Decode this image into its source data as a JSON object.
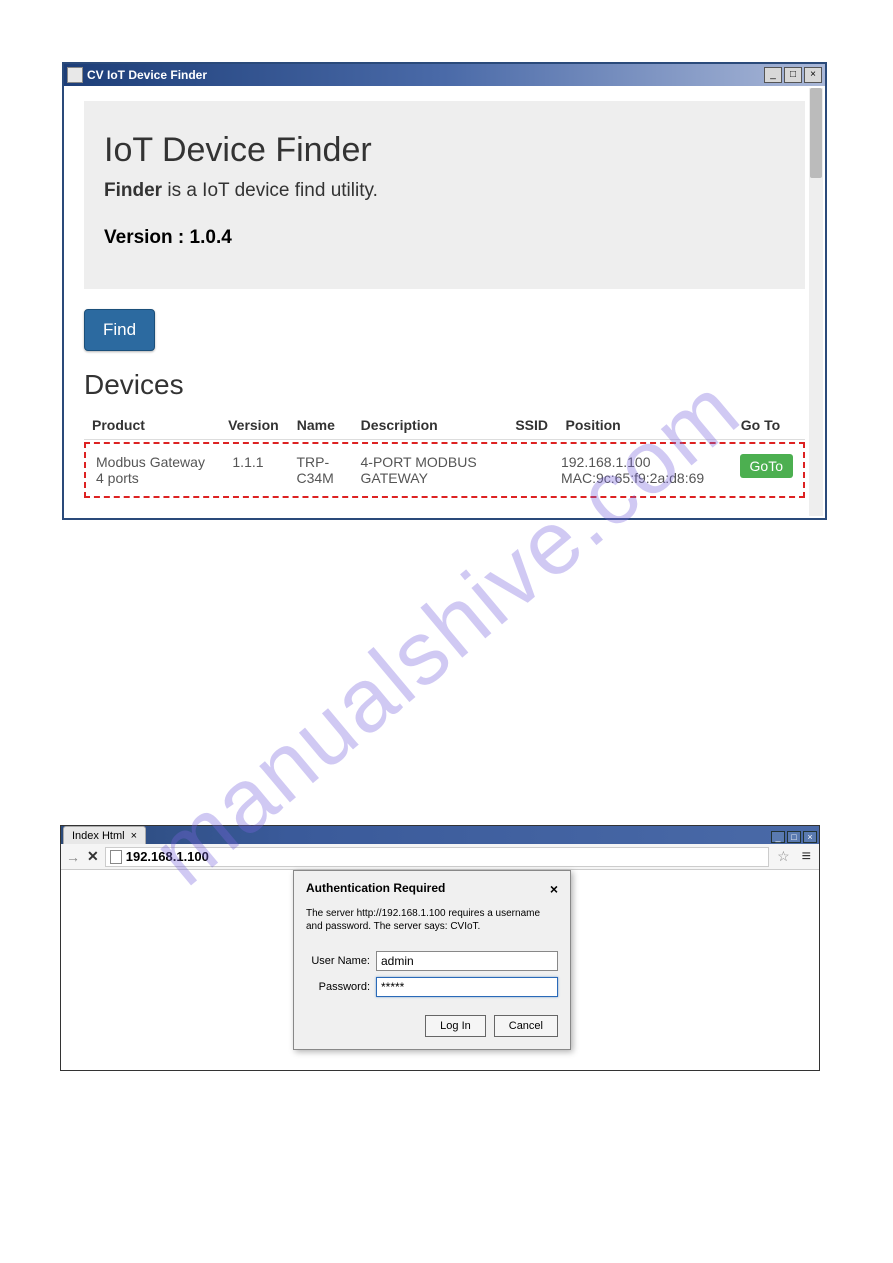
{
  "watermark": "manualshive.com",
  "window1": {
    "title": "CV IoT Device Finder",
    "heading": "IoT Device Finder",
    "desc_bold": "Finder",
    "desc_rest": " is a IoT device find utility.",
    "version_label": "Version : ",
    "version_value": "1.0.4",
    "find_button": "Find",
    "devices_heading": "Devices",
    "columns": {
      "product": "Product",
      "version": "Version",
      "name": "Name",
      "description": "Description",
      "ssid": "SSID",
      "position": "Position",
      "goto": "Go To"
    },
    "row": {
      "product": "Modbus Gateway 4 ports",
      "version": "1.1.1",
      "name": "TRP-C34M",
      "description": "4-PORT MODBUS GATEWAY",
      "ssid": "",
      "position_ip": "192.168.1.100",
      "position_mac": "MAC:9c:65:f9:2a:d8:69",
      "goto_button": "GoTo"
    }
  },
  "window2": {
    "tab_title": "Index Html",
    "url": "192.168.1.100",
    "auth": {
      "title": "Authentication Required",
      "message": "The server http://192.168.1.100 requires a username and password. The server says: CVIoT.",
      "username_label": "User Name:",
      "username_value": "admin",
      "password_label": "Password:",
      "password_value": "*****",
      "login_button": "Log In",
      "cancel_button": "Cancel"
    }
  }
}
